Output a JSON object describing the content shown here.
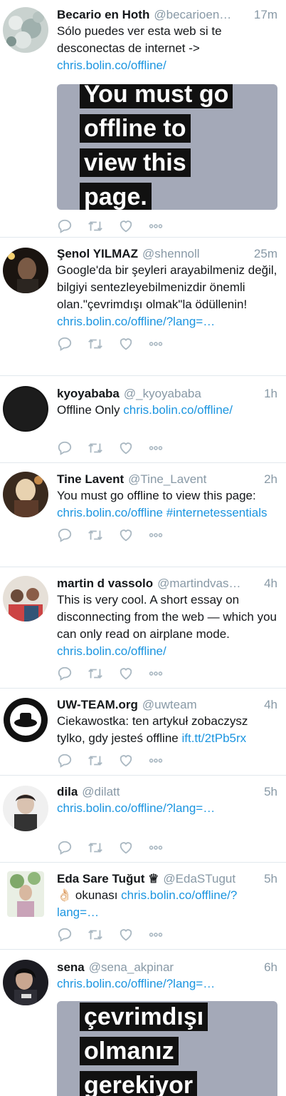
{
  "tweets": [
    {
      "name": "Becario en Hoth",
      "handle": "@becarioen…",
      "time": "17m",
      "text": "Sólo puedes ver esta web si te desconectas de internet ->",
      "link": "chris.bolin.co/offline/",
      "media_lines": [
        "You must go",
        "offline to",
        "view this",
        "page."
      ]
    },
    {
      "name": "Şenol YILMAZ",
      "handle": "@shennoll",
      "time": "25m",
      "text": "Google'da bir şeyleri arayabilmeniz değil, bilgiyi sentezleyebilmenizdir önemli olan.\"çevrimdışı olmak\"la ödüllenin!",
      "link": "chris.bolin.co/offline/?lang=…"
    },
    {
      "name": "kyoyababa",
      "handle": "@_kyoyababa",
      "time": "1h",
      "text": "Offline Only",
      "link": "chris.bolin.co/offline/"
    },
    {
      "name": "Tine Lavent",
      "handle": "@Tine_Lavent",
      "time": "2h",
      "text": "You must go offline to view this page:",
      "link": "chris.bolin.co/offline",
      "hashtag": "#internetessentials"
    },
    {
      "name": "martin d vassolo",
      "handle": "@martindvas…",
      "time": "4h",
      "text": "This is very cool. A short essay on disconnecting from the web — which you can only read on airplane mode.",
      "link": "chris.bolin.co/offline/"
    },
    {
      "name": "UW-TEAM.org",
      "handle": "@uwteam",
      "time": "4h",
      "text": "Ciekawostka: ten artykuł zobaczysz tylko, gdy jesteś offline",
      "link": "ift.tt/2tPb5rx"
    },
    {
      "name": "dila",
      "handle": "@dilatt",
      "time": "5h",
      "text": "",
      "link": "chris.bolin.co/offline/?lang=…"
    },
    {
      "name": "Eda Sare Tuğut ♕",
      "handle": "@EdaSTugut",
      "time": "5h",
      "text": "👌🏻 okunası",
      "link": "chris.bolin.co/offline/?lang=…"
    },
    {
      "name": "sena",
      "handle": "@sena_akpinar",
      "time": "6h",
      "text": "",
      "link": "chris.bolin.co/offline/?lang=…",
      "media_lines": [
        "çevrimdışı",
        "olmanız",
        "gerekiyor"
      ]
    }
  ],
  "colors": {
    "link": "#1b95e0",
    "muted": "#8899a6",
    "divider": "#e1e8ed",
    "action_icon": "#aab8c2"
  },
  "icons": {
    "reply": "reply-icon",
    "retweet": "retweet-icon",
    "like": "like-icon",
    "more": "more-icon"
  }
}
